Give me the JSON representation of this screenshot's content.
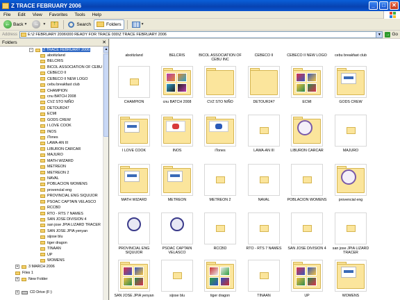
{
  "window": {
    "title": "Z TRACE FEBRUARY 2006",
    "minimize": "_",
    "maximize": "□",
    "close": "✕"
  },
  "menu": [
    "File",
    "Edit",
    "View",
    "Favorites",
    "Tools",
    "Help"
  ],
  "toolbar": {
    "back": "Back",
    "search": "Search",
    "folders": "Folders"
  },
  "address": {
    "label": "Address",
    "value": "E:\\2 FEBRUARY 2006\\000 READY FOR TRACE 000\\Z TRACE FEBRUARY 2006",
    "go": "Go"
  },
  "folders_pane": {
    "title": "Folders",
    "close": "✕",
    "selected": "Z TRACE FEBRUARY 2006",
    "children": [
      "aboitizland",
      "BELCRIS",
      "BICOL ASSOCIATION OF CEBU I",
      "CEBECO II",
      "CEBECO II NEW LOGO",
      "cebu breakfast club",
      "CHAMPION",
      "cnu BATCH 2008",
      "CVZ STO NIÑO",
      "DETOUR247",
      "ECMI",
      "GODS CREW",
      "I LOVE COOK",
      "INOS",
      "iTones",
      "LAWA-AN III",
      "LIBURON CARCAR",
      "MAJURO",
      "MATH WIZARD",
      "METREON",
      "METREON 2",
      "NAVAL",
      "POBLACION WOMENS",
      "provencial eng",
      "PROVINCIAL ENG SIQUIJOR",
      "PSOAC CAPTAIN VELASCO",
      "RCCBD",
      "RTO - RTS 7 NAMES",
      "SAN JOSE DIVISION 4",
      "san jose JPIA LIZARD TRACER",
      "SAN JOSE JPIA yenyan",
      "sijose blu",
      "tiger dragon",
      "TINAAN",
      "UP",
      "WOMENS"
    ],
    "siblings": [
      "3 MARCH 2006",
      "Files 1",
      "New Folder"
    ],
    "drive": "CD Drive (F:)"
  },
  "content": {
    "top_row_labels": [
      "aboitizland",
      "BELCRIS",
      "BICOL ASSOCIATION OF CEBU INC",
      "CEBECO II",
      "CEBECO II NEW LOGO",
      "cebu breakfast club"
    ],
    "items": [
      {
        "label": "CHAMPION",
        "style": "plain"
      },
      {
        "label": "cnu BATCH 2008",
        "style": "photo"
      },
      {
        "label": "CVZ STO NIÑO",
        "style": "folder"
      },
      {
        "label": "DETOUR247",
        "style": "folder"
      },
      {
        "label": "ECMI",
        "style": "photo"
      },
      {
        "label": "GODS CREW",
        "style": "docfolder"
      },
      {
        "label": "I LOVE COOK",
        "style": "docfolder"
      },
      {
        "label": "INOS",
        "style": "logofolder"
      },
      {
        "label": "iTones",
        "style": "logofolder"
      },
      {
        "label": "LAWA-AN III",
        "style": "plain"
      },
      {
        "label": "LIBURON CARCAR",
        "style": "sealfolder"
      },
      {
        "label": "MAJURO",
        "style": "plain"
      },
      {
        "label": "MATH WIZARD",
        "style": "docfolder"
      },
      {
        "label": "METREON",
        "style": "docfolder"
      },
      {
        "label": "METREON 2",
        "style": "plain"
      },
      {
        "label": "NAVAL",
        "style": "plain"
      },
      {
        "label": "POBLACION WOMENS",
        "style": "plain"
      },
      {
        "label": "provencial eng",
        "style": "sealfolder"
      },
      {
        "label": "PROVINCIAL ENG SIQUIJOR",
        "style": "sealplain"
      },
      {
        "label": "PSOAC CAPTAIN VELASCO",
        "style": "sealplain"
      },
      {
        "label": "RCCBD",
        "style": "plain"
      },
      {
        "label": "RTO - RTS 7 NAMES",
        "style": "plain"
      },
      {
        "label": "SAN JOSE DIVISION 4",
        "style": "plain"
      },
      {
        "label": "san jose JPIA LIZARD TRACER",
        "style": "plain"
      },
      {
        "label": "SAN JOSE JPIA yenyan",
        "style": "photo"
      },
      {
        "label": "sijose blu",
        "style": "plain"
      },
      {
        "label": "tiger dragon",
        "style": "photo"
      },
      {
        "label": "TINAAN",
        "style": "plain"
      },
      {
        "label": "UP",
        "style": "photo"
      },
      {
        "label": "WOMENS",
        "style": "docfolder"
      }
    ]
  }
}
